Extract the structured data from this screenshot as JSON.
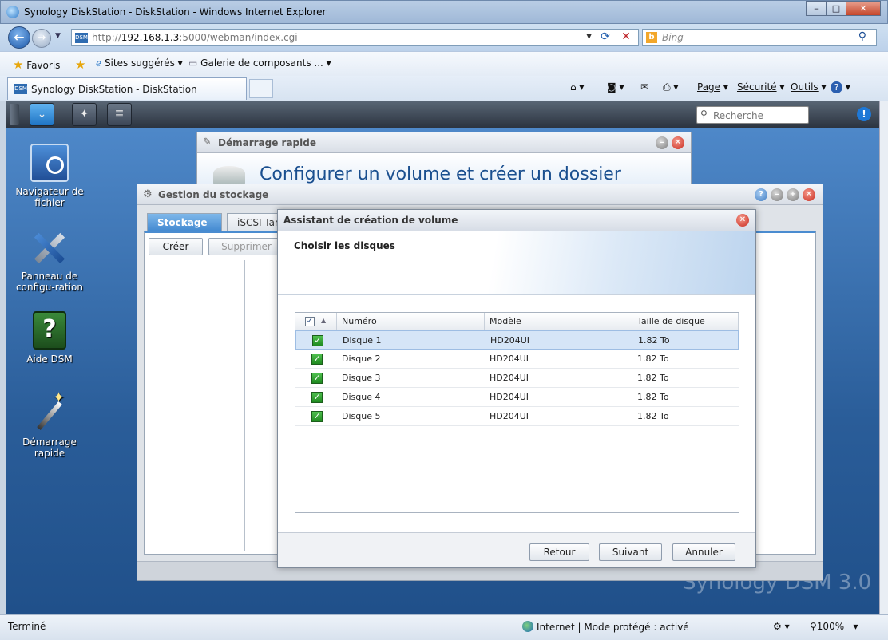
{
  "browser": {
    "title": "Synology DiskStation - DiskStation - Windows Internet Explorer",
    "window_buttons": [
      "–",
      "□",
      "✕"
    ],
    "address": {
      "prefix": "http://",
      "host": "192.168.1.3",
      "rest": ":5000/webman/index.cgi"
    },
    "search_placeholder": "Bing",
    "favorites": {
      "label": "Favoris",
      "suggested": "Sites suggérés",
      "gallery": "Galerie de composants ..."
    },
    "tab_title": "Synology DiskStation - DiskStation",
    "commands": {
      "page": "Page",
      "security": "Sécurité",
      "tools": "Outils"
    },
    "status": {
      "left": "Terminé",
      "zone": "Internet | Mode protégé : activé",
      "zoom": "100%"
    }
  },
  "dsm": {
    "search_placeholder": "Recherche",
    "watermark": "Synology DSM 3.0",
    "desktop_icons": [
      {
        "label": "Navigateur de fichier"
      },
      {
        "label": "Panneau de configu-ration"
      },
      {
        "label": "Aide DSM"
      },
      {
        "label": "Démarrage rapide"
      }
    ],
    "quick_start": {
      "title": "Démarrage rapide",
      "heading": "Configurer un volume et créer un dossier"
    },
    "storage": {
      "title": "Gestion du stockage",
      "tabs": [
        "Stockage",
        "iSCSI Target"
      ],
      "buttons": {
        "create": "Créer",
        "delete": "Supprimer"
      }
    },
    "wizard": {
      "title": "Assistant de création de volume",
      "step": "Choisir les disques",
      "columns": {
        "number": "Numéro",
        "model": "Modèle",
        "size": "Taille de disque"
      },
      "rows": [
        {
          "number": "Disque 1",
          "model": "HD204UI",
          "size": "1.82 To"
        },
        {
          "number": "Disque 2",
          "model": "HD204UI",
          "size": "1.82 To"
        },
        {
          "number": "Disque 3",
          "model": "HD204UI",
          "size": "1.82 To"
        },
        {
          "number": "Disque 4",
          "model": "HD204UI",
          "size": "1.82 To"
        },
        {
          "number": "Disque 5",
          "model": "HD204UI",
          "size": "1.82 To"
        }
      ],
      "buttons": {
        "back": "Retour",
        "next": "Suivant",
        "cancel": "Annuler"
      }
    }
  }
}
